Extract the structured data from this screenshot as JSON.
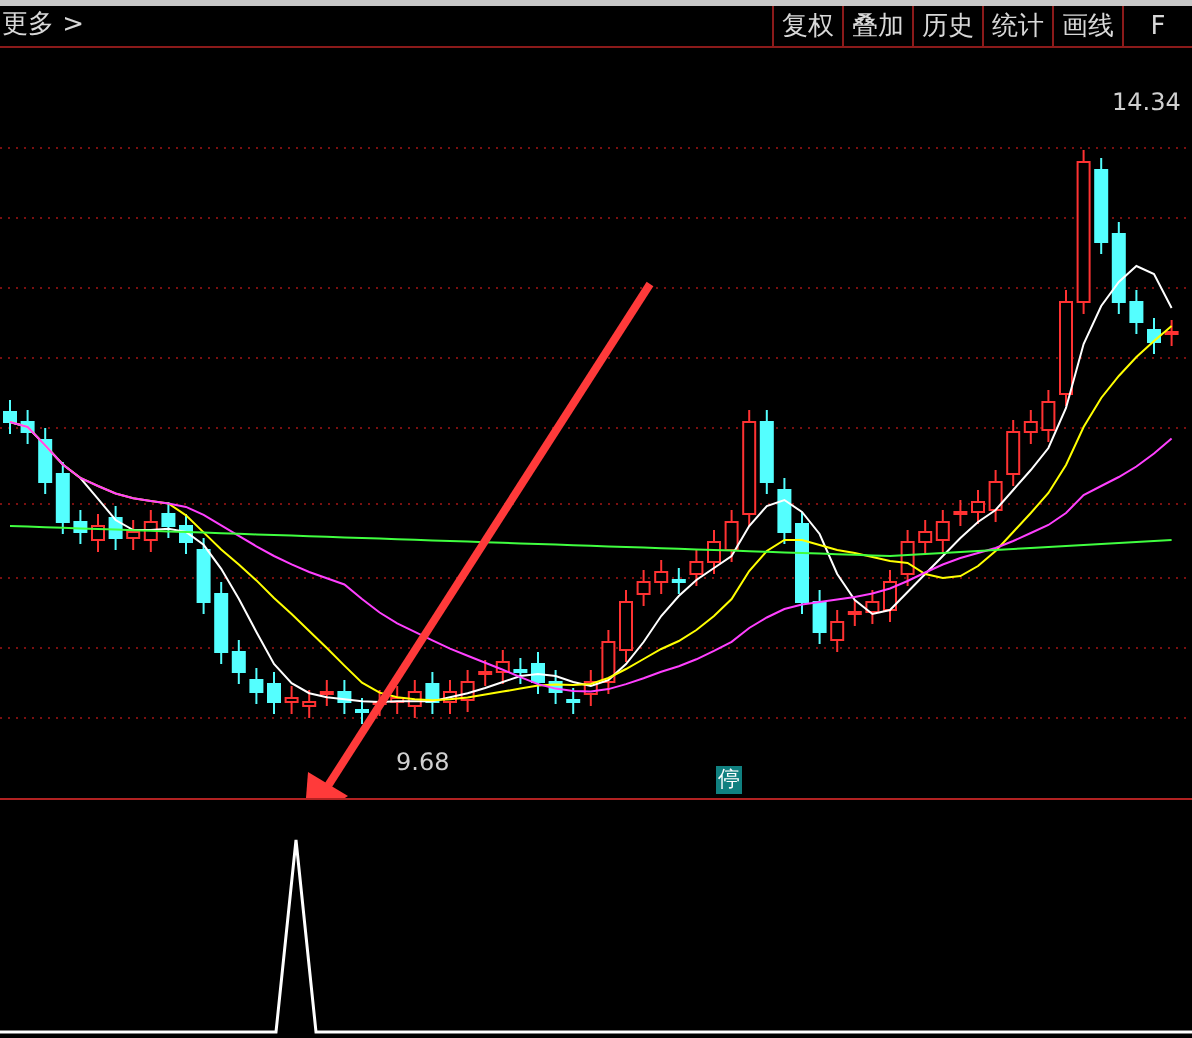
{
  "toolbar": {
    "more": "更多 >",
    "buttons": [
      "复权",
      "叠加",
      "历史",
      "统计",
      "画线",
      "F"
    ]
  },
  "chart": {
    "high_label": "14.34",
    "low_label": "9.68",
    "marker": "停"
  }
}
